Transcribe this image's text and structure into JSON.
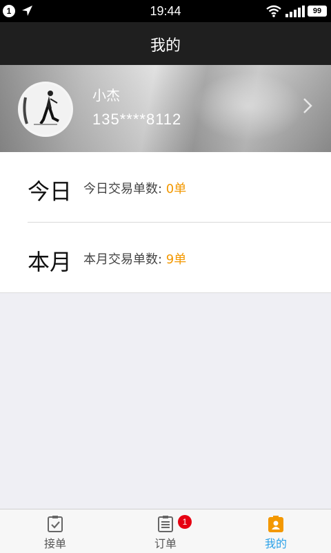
{
  "status_bar": {
    "notification_count": "1",
    "time": "19:44",
    "battery": "99"
  },
  "nav": {
    "title": "我的"
  },
  "profile": {
    "name": "小杰",
    "phone": "135****8112"
  },
  "stats": [
    {
      "period": "今日",
      "label": "今日交易单数: ",
      "value": "0单"
    },
    {
      "period": "本月",
      "label": "本月交易单数: ",
      "value": "9单"
    }
  ],
  "tabs": [
    {
      "label": "接单",
      "icon": "clipboard-check-icon"
    },
    {
      "label": "订单",
      "icon": "list-doc-icon",
      "badge": "1"
    },
    {
      "label": "我的",
      "icon": "profile-badge-icon",
      "active": true
    }
  ],
  "colors": {
    "accent_orange": "#f39800",
    "active_blue": "#2ba1e8",
    "badge_red": "#e60012"
  }
}
